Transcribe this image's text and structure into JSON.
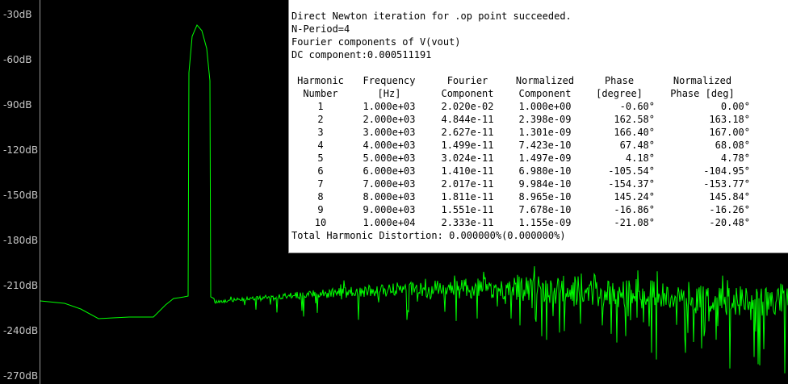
{
  "plot": {
    "axis_labels": [
      "-30dB",
      "-60dB",
      "-90dB",
      "-120dB",
      "-150dB",
      "-180dB",
      "-210dB",
      "-240dB",
      "-270dB"
    ],
    "trace_color": "#00ff00",
    "background": "#000000"
  },
  "log": {
    "line1": "Direct Newton iteration for .op point succeeded.",
    "line2": "N-Period=4",
    "line3": "Fourier components of V(vout)",
    "line4": "DC component:0.000511191",
    "headers_row1": [
      "Harmonic",
      "Frequency",
      "Fourier",
      "Normalized",
      "Phase",
      "Normalized"
    ],
    "headers_row2": [
      "Number",
      "[Hz]",
      "Component",
      "Component",
      "[degree]",
      "Phase [deg]"
    ],
    "rows": [
      [
        "1",
        "1.000e+03",
        "2.020e-02",
        "1.000e+00",
        "-0.60°",
        "0.00°"
      ],
      [
        "2",
        "2.000e+03",
        "4.844e-11",
        "2.398e-09",
        "162.58°",
        "163.18°"
      ],
      [
        "3",
        "3.000e+03",
        "2.627e-11",
        "1.301e-09",
        "166.40°",
        "167.00°"
      ],
      [
        "4",
        "4.000e+03",
        "1.499e-11",
        "7.423e-10",
        "67.48°",
        "68.08°"
      ],
      [
        "5",
        "5.000e+03",
        "3.024e-11",
        "1.497e-09",
        "4.18°",
        "4.78°"
      ],
      [
        "6",
        "6.000e+03",
        "1.410e-11",
        "6.980e-10",
        "-105.54°",
        "-104.95°"
      ],
      [
        "7",
        "7.000e+03",
        "2.017e-11",
        "9.984e-10",
        "-154.37°",
        "-153.77°"
      ],
      [
        "8",
        "8.000e+03",
        "1.811e-11",
        "8.965e-10",
        "145.24°",
        "145.84°"
      ],
      [
        "9",
        "9.000e+03",
        "1.551e-11",
        "7.678e-10",
        "-16.86°",
        "-16.26°"
      ],
      [
        "10",
        "1.000e+04",
        "2.333e-11",
        "1.155e-09",
        "-21.08°",
        "-20.48°"
      ]
    ],
    "thd": "Total Harmonic Distortion: 0.000000%(0.000000%)"
  }
}
